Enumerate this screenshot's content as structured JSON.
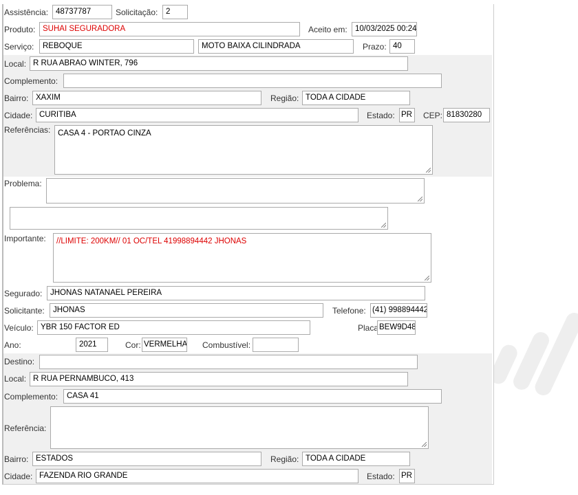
{
  "header": {
    "assistencia_label": "Assistência:",
    "assistencia": "48737787",
    "solicitacao_label": "Solicitação:",
    "solicitacao": "2",
    "produto_label": "Produto:",
    "produto": "SUHAI SEGURADORA",
    "aceito_label": "Aceito em:",
    "aceito": "10/03/2025 00:24",
    "servico_label": "Serviço:",
    "servico": "REBOQUE",
    "servico_tipo": "MOTO BAIXA CILINDRADA",
    "prazo_label": "Prazo:",
    "prazo": "40"
  },
  "origem": {
    "local_label": "Local:",
    "local": "R RUA ABRAO WINTER, 796",
    "complemento_label": "Complemento:",
    "complemento": "",
    "bairro_label": "Bairro:",
    "bairro": "XAXIM",
    "regiao_label": "Região:",
    "regiao": "TODA A CIDADE",
    "cidade_label": "Cidade:",
    "cidade": "CURITIBA",
    "estado_label": "Estado:",
    "estado": "PR",
    "cep_label": "CEP:",
    "cep": "81830280",
    "referencias_label": "Referências:",
    "referencias": "CASA 4 - PORTAO CINZA"
  },
  "problema": {
    "label": "Problema:",
    "value": "",
    "extra": ""
  },
  "importante": {
    "label": "Importante:",
    "value": "//LIMITE: 200KM// 01 OC/TEL 41998894442 JHONAS"
  },
  "cliente": {
    "segurado_label": "Segurado:",
    "segurado": "JHONAS NATANAEL PEREIRA",
    "solicitante_label": "Solicitante:",
    "solicitante": "JHONAS",
    "telefone_label": "Telefone:",
    "telefone": "(41) 998894442",
    "veiculo_label": "Veículo:",
    "veiculo": "YBR 150 FACTOR ED",
    "placa_label": "Placa:",
    "placa": "BEW9D48",
    "ano_label": "Ano:",
    "ano": "2021",
    "cor_label": "Cor:",
    "cor": "VERMELHA",
    "combustivel_label": "Combustível:",
    "combustivel": ""
  },
  "destino": {
    "destino_label": "Destino:",
    "destino": "",
    "local_label": "Local:",
    "local": "R RUA PERNAMBUCO, 413",
    "complemento_label": "Complemento:",
    "complemento": "CASA 41",
    "referencia_label": "Referência:",
    "referencia": "",
    "bairro_label": "Bairro:",
    "bairro": "ESTADOS",
    "regiao_label": "Região:",
    "regiao": "TODA A CIDADE",
    "cidade_label": "Cidade:",
    "cidade": "FAZENDA RIO GRANDE",
    "estado_label": "Estado:",
    "estado": "PR"
  },
  "colors": {
    "highlight": "#dd0000",
    "band": "#f0f0f0"
  }
}
